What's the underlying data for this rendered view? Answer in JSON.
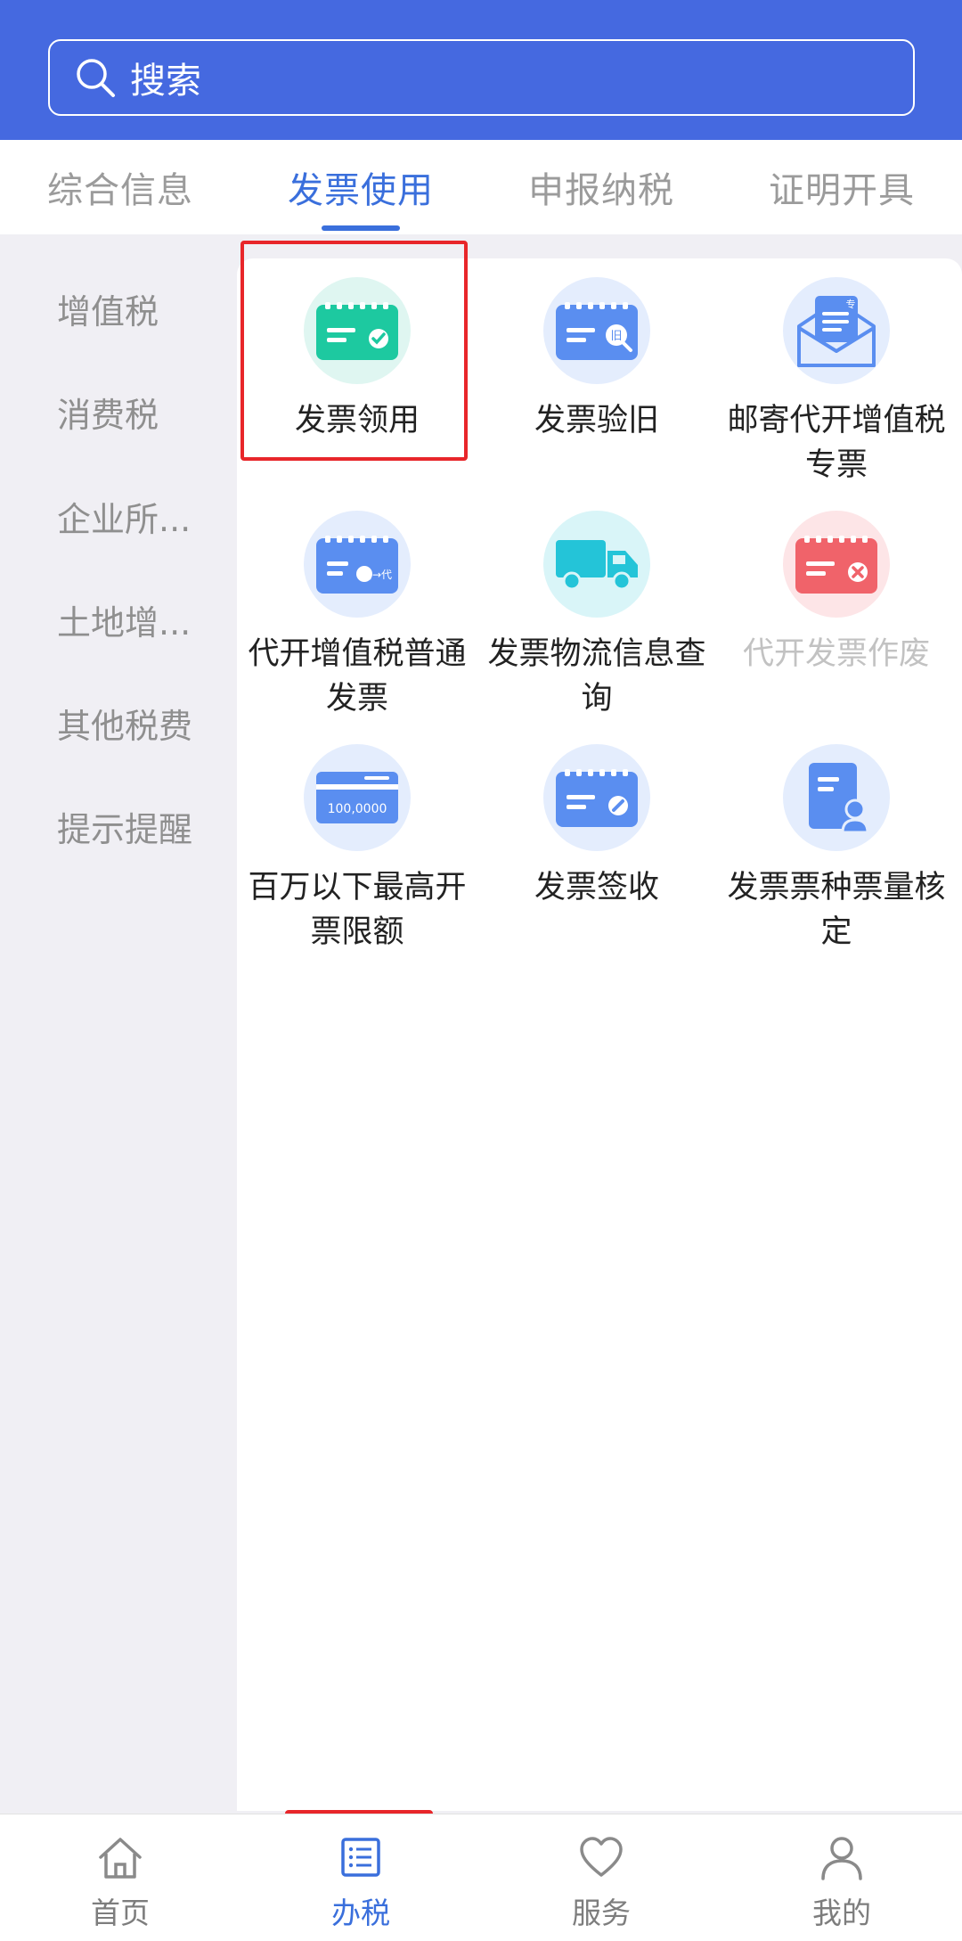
{
  "search": {
    "placeholder": "搜索"
  },
  "tabs": [
    {
      "label": "综合信息",
      "active": false
    },
    {
      "label": "发票使用",
      "active": true
    },
    {
      "label": "申报纳税",
      "active": false
    },
    {
      "label": "证明开具",
      "active": false
    }
  ],
  "sidebar": {
    "items": [
      {
        "label": "增值税"
      },
      {
        "label": "消费税"
      },
      {
        "label": "企业所..."
      },
      {
        "label": "土地增..."
      },
      {
        "label": "其他税费"
      },
      {
        "label": "提示提醒"
      }
    ]
  },
  "grid": {
    "items": [
      {
        "label": "发票领用",
        "icon": "invoice-check-icon",
        "enabled": true
      },
      {
        "label": "发票验旧",
        "icon": "invoice-verify-old-icon",
        "enabled": true,
        "icon_text": "旧"
      },
      {
        "label": "邮寄代开增值税专票",
        "icon": "mail-envelope-icon",
        "enabled": true,
        "icon_text": "专"
      },
      {
        "label": "代开增值税普通发票",
        "icon": "invoice-proxy-icon",
        "enabled": true,
        "icon_text": "增→代"
      },
      {
        "label": "发票物流信息查询",
        "icon": "delivery-truck-icon",
        "enabled": true
      },
      {
        "label": "代开发票作废",
        "icon": "invoice-void-icon",
        "enabled": false
      },
      {
        "label": "百万以下最高开票限额",
        "icon": "card-limit-icon",
        "enabled": true,
        "icon_text": "100,0000"
      },
      {
        "label": "发票签收",
        "icon": "invoice-sign-icon",
        "enabled": true
      },
      {
        "label": "发票票种票量核定",
        "icon": "document-stamp-icon",
        "enabled": true
      }
    ]
  },
  "bottom_nav": {
    "items": [
      {
        "label": "首页",
        "icon": "home-icon",
        "active": false
      },
      {
        "label": "办税",
        "icon": "tax-list-icon",
        "active": true
      },
      {
        "label": "服务",
        "icon": "heart-icon",
        "active": false
      },
      {
        "label": "我的",
        "icon": "user-icon",
        "active": false
      }
    ]
  },
  "colors": {
    "header": "#4569e0",
    "accent": "#3a6fdc",
    "highlight": "#e8262a",
    "icon_green": "#1dc9a0",
    "icon_blue": "#5a8ef0",
    "icon_red": "#f0636a"
  }
}
